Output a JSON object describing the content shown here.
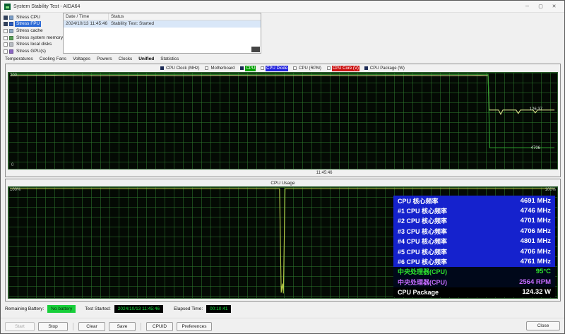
{
  "window": {
    "title": "System Stability Test - AIDA64",
    "minimize_glyph": "─",
    "maximize_glyph": "▢",
    "close_glyph": "✕"
  },
  "stress": {
    "items": [
      {
        "label": "Stress CPU",
        "checked": true,
        "selected": false,
        "icon_style": "background:#7a9cc6"
      },
      {
        "label": "Stress FPU",
        "checked": true,
        "selected": true,
        "icon_style": "background:#2f5fbf"
      },
      {
        "label": "Stress cache",
        "checked": false,
        "selected": false,
        "icon_style": "background:#93adc4"
      },
      {
        "label": "Stress system memory",
        "checked": false,
        "selected": false,
        "icon_style": "background:#58a058"
      },
      {
        "label": "Stress local disks",
        "checked": false,
        "selected": false,
        "icon_style": "background:#b7bcc2"
      },
      {
        "label": "Stress GPU(s)",
        "checked": false,
        "selected": false,
        "icon_style": "background:#8a66c2"
      }
    ]
  },
  "log": {
    "col_datetime": "Date / Time",
    "col_status": "Status",
    "rows": [
      {
        "datetime": "2024/10/13 11:45:46",
        "status": "Stability Test: Started"
      }
    ]
  },
  "tabs": {
    "items": [
      {
        "label": "Temperatures",
        "selected": false
      },
      {
        "label": "Cooling Fans",
        "selected": false
      },
      {
        "label": "Voltages",
        "selected": false
      },
      {
        "label": "Powers",
        "selected": false
      },
      {
        "label": "Clocks",
        "selected": false
      },
      {
        "label": "Unified",
        "selected": true
      },
      {
        "label": "Statistics",
        "selected": false
      }
    ]
  },
  "chart_top": {
    "legend": [
      {
        "label": "CPU Clock (MHz)",
        "checked": true,
        "style": ""
      },
      {
        "label": "Motherboard",
        "checked": false,
        "style": ""
      },
      {
        "label": "CPU",
        "checked": true,
        "style": "background:#00a000;color:#ffffff"
      },
      {
        "label": "CPU Diode",
        "checked": false,
        "style": "background:#2222dd;color:#ffffff"
      },
      {
        "label": "CPU (RPM)",
        "checked": false,
        "style": ""
      },
      {
        "label": "CPU Core (V)",
        "checked": false,
        "style": "background:#cc1414;color:#ffffff"
      },
      {
        "label": "CPU Package (W)",
        "checked": true,
        "style": ""
      }
    ],
    "y_max": "200",
    "y_min": "0",
    "x_tick": "11:45:46",
    "value_label_1": "126.37",
    "value_label_2": "4706"
  },
  "chart_usage": {
    "title": "CPU Usage",
    "y_left": "100%",
    "y_right": "100%"
  },
  "stats": {
    "rows": [
      {
        "label": "CPU 核心频率",
        "value": "4691 MHz",
        "style": "background:#1522cd;color:#ffffff"
      },
      {
        "label": "#1 CPU 核心频率",
        "value": "4746 MHz",
        "style": "background:#1522cd;color:#ffffff"
      },
      {
        "label": "#2 CPU 核心频率",
        "value": "4701 MHz",
        "style": "background:#1522cd;color:#ffffff"
      },
      {
        "label": "#3 CPU 核心频率",
        "value": "4706 MHz",
        "style": "background:#1522cd;color:#ffffff"
      },
      {
        "label": "#4 CPU 核心频率",
        "value": "4801 MHz",
        "style": "background:#1522cd;color:#ffffff"
      },
      {
        "label": "#5 CPU 核心频率",
        "value": "4706 MHz",
        "style": "background:#1522cd;color:#ffffff"
      },
      {
        "label": "#6 CPU 核心频率",
        "value": "4761 MHz",
        "style": "background:#1522cd;color:#ffffff"
      },
      {
        "label": "中央处理器(CPU)",
        "value": "95°C",
        "style": "background:#00081a;color:#2ee62e"
      },
      {
        "label": "中央处理器(CPU)",
        "value": "2564 RPM",
        "style": "background:#00081a;color:#c66bff"
      },
      {
        "label": "CPU Package",
        "value": "124.32 W",
        "style": "background:#000000;color:#ffffff"
      }
    ]
  },
  "statusbar": {
    "battery_label": "Remaining Battery:",
    "battery_value": "No battery",
    "started_label": "Test Started:",
    "started_value": "2024/10/13 11:45:46",
    "elapsed_label": "Elapsed Time:",
    "elapsed_value": "00:10:41"
  },
  "buttons": {
    "start": "Start",
    "stop": "Stop",
    "clear": "Clear",
    "save": "Save",
    "cpuid": "CPUID",
    "preferences": "Preferences",
    "close": "Close"
  },
  "chart_data": [
    {
      "type": "line",
      "title": "Unified sensor graph",
      "ylabel_left_range": [
        0,
        200
      ],
      "x_end_label": "11:45:46",
      "grid": true,
      "series": [
        {
          "name": "CPU Package (W)",
          "color": "#d6dd88",
          "points": [
            [
              4,
              30
            ],
            [
              80,
              26
            ],
            [
              160,
              32
            ],
            [
              240,
              27
            ],
            [
              320,
              31
            ],
            [
              400,
              27
            ],
            [
              480,
              31
            ],
            [
              560,
              27
            ],
            [
              640,
              31
            ],
            [
              720,
              28
            ],
            [
              800,
              31
            ],
            [
              860,
              28
            ],
            [
              874,
              30
            ],
            [
              876,
              388
            ],
            [
              893,
              388
            ],
            [
              897,
              432
            ],
            [
              901,
              388
            ],
            [
              925,
              388
            ],
            [
              929,
              424
            ],
            [
              933,
              388
            ],
            [
              956,
              388
            ],
            [
              960,
              418
            ],
            [
              964,
              388
            ],
            [
              995,
              388
            ]
          ]
        },
        {
          "name": "CPU Clock (MHz)",
          "color": "#2f9e2f",
          "points": [
            [
              4,
              16
            ],
            [
              874,
              16
            ],
            [
              877,
              782
            ],
            [
              995,
              782
            ]
          ]
        }
      ],
      "end_values": {
        "cpu_package_w": 126.37,
        "cpu_clock_mhz": 4706
      }
    },
    {
      "type": "line",
      "title": "CPU Usage",
      "ylim": [
        0,
        100
      ],
      "grid": true,
      "series": [
        {
          "name": "CPU Usage (%)",
          "color": "#b9cf49",
          "points": [
            [
              3,
              14
            ],
            [
              494,
              14
            ],
            [
              497,
              952
            ],
            [
              499,
              870
            ],
            [
              501,
              958
            ],
            [
              504,
              14
            ],
            [
              996,
              14
            ]
          ]
        }
      ]
    }
  ]
}
